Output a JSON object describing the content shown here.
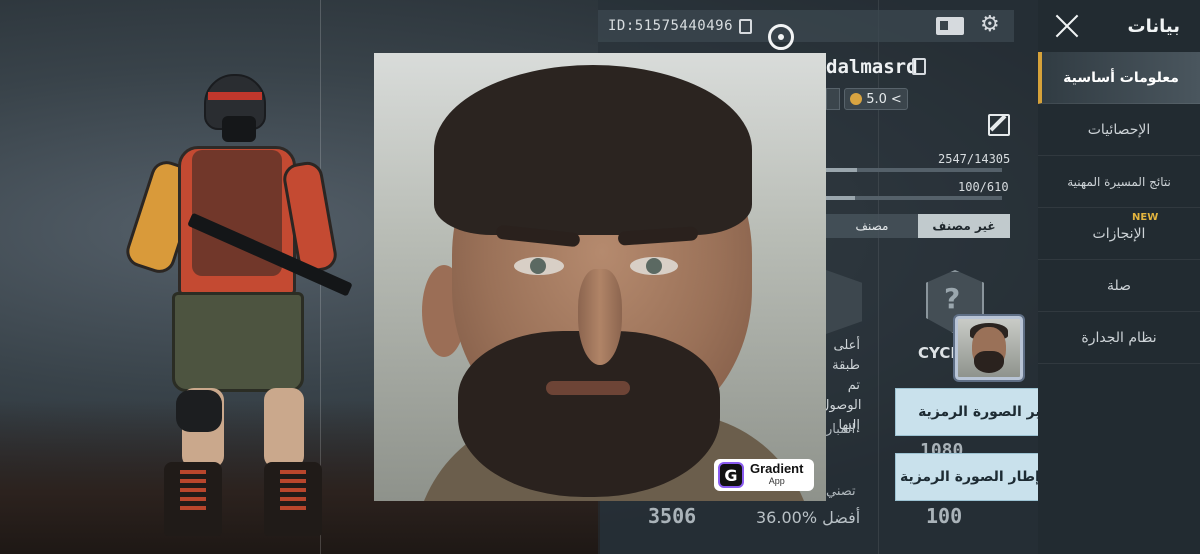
{
  "profile": {
    "id_label": "ID:51575440496",
    "username": "dalmasrd",
    "rating": "5.0",
    "rating_arrow": "<",
    "progress1_text": "2547/14305",
    "progress1_value": 0.178,
    "progress2_text": "100/610",
    "progress2_value": 0.164,
    "tabs": [
      {
        "label": "غير مصنف"
      },
      {
        "label": "مصنف"
      }
    ],
    "cycle_label": "CYCLE",
    "rank_caption": "أعلى طبقة تم الوصول إليها",
    "stat_partial_1": "المبار",
    "stat_partial_2": "تصني",
    "stat_partial_3": "1080",
    "stat_bottom_left": "3506",
    "stat_bottom_mid": "أفضل %36.00",
    "stat_bottom_right": "100",
    "rank_question": "?"
  },
  "watermark": {
    "logo_letter": "G",
    "title": "Gradient",
    "subtitle": "App"
  },
  "actions": {
    "change_avatar": "تغيير الصورة الرمزية",
    "change_avatar_frame": "تغيير إطار الصورة الرمزية"
  },
  "sidebar": {
    "title": "بيانات",
    "items": [
      {
        "label": "معلومات أساسية",
        "active": true
      },
      {
        "label": "الإحصائيات",
        "active": false
      },
      {
        "label": "نتائج المسيرة المهنية",
        "active": false
      },
      {
        "label": "الإنجازات",
        "active": false
      },
      {
        "label": "صلة",
        "active": false
      },
      {
        "label": "نظام الجدارة",
        "active": false
      }
    ],
    "new_badge": "NEW"
  },
  "colors": {
    "accent_gold": "#d6a23a",
    "button_bg": "#c9e1ec",
    "sidebar_bg": "#222b31"
  },
  "icons": [
    "copy-icon",
    "card-icon",
    "gear-icon",
    "crosshair-icon",
    "edit-icon",
    "close-icon",
    "smile-icon"
  ]
}
